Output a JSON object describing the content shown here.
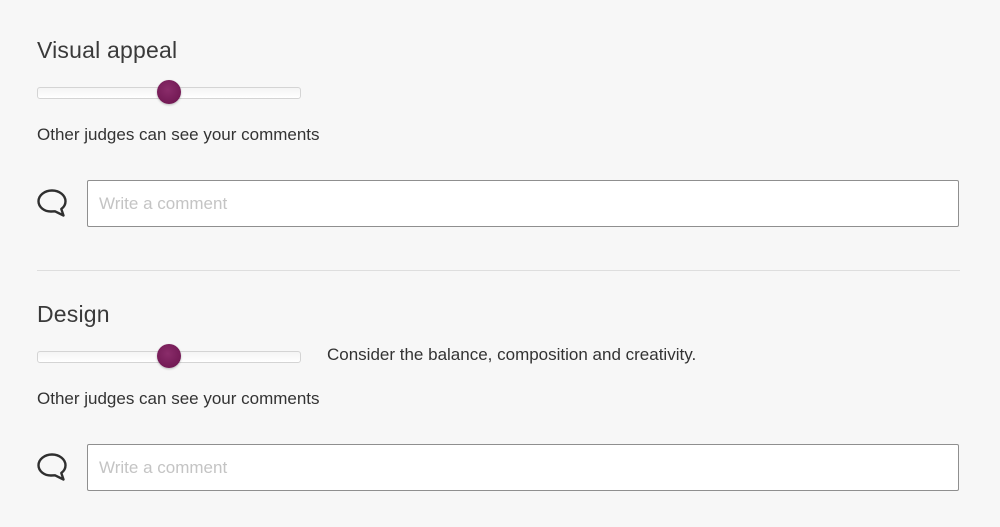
{
  "sections": [
    {
      "title": "Visual appeal",
      "slider": {
        "value_fraction": 0.5
      },
      "hint": "",
      "visibility_note": "Other judges can see your comments",
      "comment": {
        "placeholder": "Write a comment",
        "value": ""
      },
      "icon": "speech-bubble-icon"
    },
    {
      "title": "Design",
      "slider": {
        "value_fraction": 0.5
      },
      "hint": "Consider the balance, composition and creativity.",
      "visibility_note": "Other judges can see your comments",
      "comment": {
        "placeholder": "Write a comment",
        "value": ""
      },
      "icon": "speech-bubble-icon"
    }
  ],
  "colors": {
    "slider_thumb": "#731a55",
    "background": "#f7f7f7"
  }
}
